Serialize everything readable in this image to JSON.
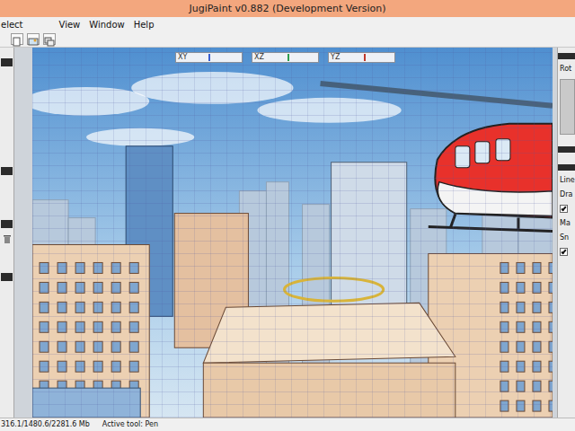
{
  "window": {
    "title": "JugiPaint v0.882 (Development Version)"
  },
  "menu": [
    {
      "label": "elect"
    },
    {
      "label": "View"
    },
    {
      "label": "Window"
    },
    {
      "label": "Help"
    }
  ],
  "axis_views": [
    {
      "label": "XY",
      "level": 0.49,
      "color": "#3a5fd0"
    },
    {
      "label": "XZ",
      "level": 0.53,
      "color": "#2e9e4f"
    },
    {
      "label": "YZ",
      "level": 0.53,
      "color": "#c0392b"
    }
  ],
  "right_panel": {
    "title": "Rot",
    "rows": [
      {
        "kind": "label",
        "label": "Line"
      },
      {
        "kind": "label",
        "label": "Dra"
      },
      {
        "kind": "check",
        "checked": true
      },
      {
        "kind": "label",
        "label": "Ma"
      },
      {
        "kind": "label",
        "label": "Sn"
      },
      {
        "kind": "check",
        "checked": true
      }
    ]
  },
  "status_bar": {
    "memory": "316.1/1480.6/2281.6 Mb",
    "active_tool": "Active tool: Pen"
  }
}
